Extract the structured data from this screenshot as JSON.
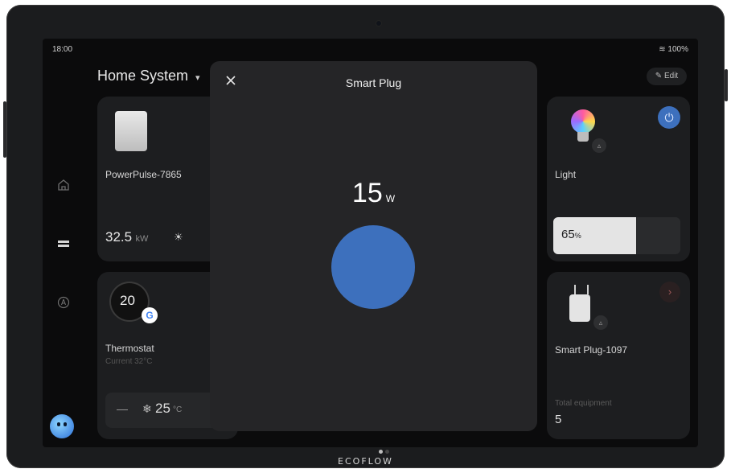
{
  "status": {
    "time": "18:00",
    "battery": "100%"
  },
  "header": {
    "title": "Home System",
    "edit_label": "Edit"
  },
  "cards": {
    "powerpulse": {
      "name": "PowerPulse-7865",
      "power_value": "32.5",
      "power_unit": "kW"
    },
    "thermostat": {
      "temp": "20",
      "name": "Thermostat",
      "current": "Current 32°C",
      "minus": "—",
      "set_temp": "25",
      "set_unit": "°C"
    },
    "light": {
      "name": "Light",
      "brightness": 65,
      "brightness_value": "65",
      "brightness_unit": "%"
    },
    "smart_plug": {
      "name": "Smart Plug-1097",
      "total_label": "Total equipment",
      "total_value": "5"
    }
  },
  "modal": {
    "title": "Smart Plug",
    "power_value": "15",
    "power_unit": "W"
  },
  "brand": "ECOFLOW",
  "colors": {
    "accent": "#3d70bd",
    "background": "#0b0b0c",
    "card": "#1d1e20",
    "modal": "#252527"
  }
}
